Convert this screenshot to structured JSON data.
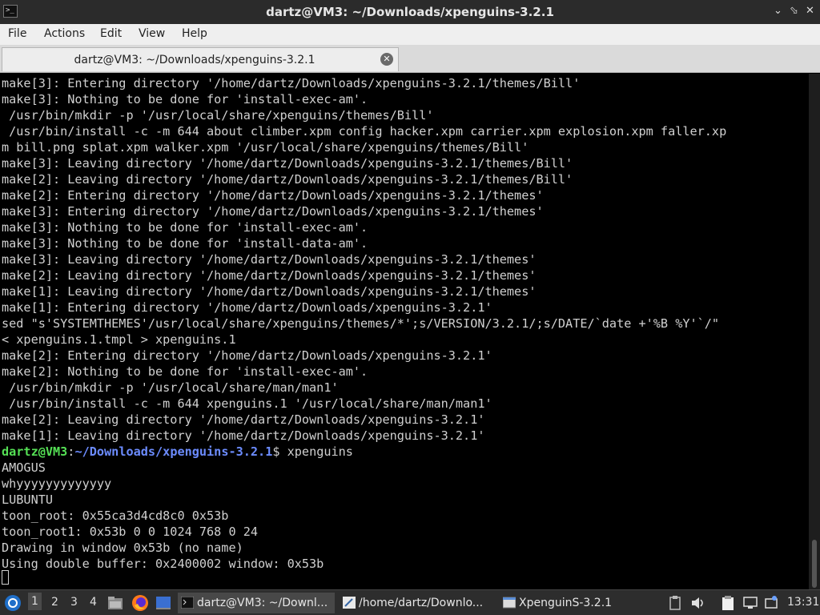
{
  "window": {
    "title": "dartz@VM3: ~/Downloads/xpenguins-3.2.1",
    "app_icon_glyph": ">_",
    "controls": [
      "⌄",
      "⬂",
      "✕"
    ]
  },
  "menu": {
    "items": [
      "File",
      "Actions",
      "Edit",
      "View",
      "Help"
    ]
  },
  "tab": {
    "title": "dartz@VM3: ~/Downloads/xpenguins-3.2.1",
    "close_glyph": "✕"
  },
  "terminal": {
    "lines": [
      "make[3]: Entering directory '/home/dartz/Downloads/xpenguins-3.2.1/themes/Bill'",
      "make[3]: Nothing to be done for 'install-exec-am'.",
      " /usr/bin/mkdir -p '/usr/local/share/xpenguins/themes/Bill'",
      " /usr/bin/install -c -m 644 about climber.xpm config hacker.xpm carrier.xpm explosion.xpm faller.xp",
      "m bill.png splat.xpm walker.xpm '/usr/local/share/xpenguins/themes/Bill'",
      "make[3]: Leaving directory '/home/dartz/Downloads/xpenguins-3.2.1/themes/Bill'",
      "make[2]: Leaving directory '/home/dartz/Downloads/xpenguins-3.2.1/themes/Bill'",
      "make[2]: Entering directory '/home/dartz/Downloads/xpenguins-3.2.1/themes'",
      "make[3]: Entering directory '/home/dartz/Downloads/xpenguins-3.2.1/themes'",
      "make[3]: Nothing to be done for 'install-exec-am'.",
      "make[3]: Nothing to be done for 'install-data-am'.",
      "make[3]: Leaving directory '/home/dartz/Downloads/xpenguins-3.2.1/themes'",
      "make[2]: Leaving directory '/home/dartz/Downloads/xpenguins-3.2.1/themes'",
      "make[1]: Leaving directory '/home/dartz/Downloads/xpenguins-3.2.1/themes'",
      "make[1]: Entering directory '/home/dartz/Downloads/xpenguins-3.2.1'",
      "sed \"s'SYSTEMTHEMES'/usr/local/share/xpenguins/themes/*';s/VERSION/3.2.1/;s/DATE/`date +'%B %Y'`/\"",
      "< xpenguins.1.tmpl > xpenguins.1",
      "make[2]: Entering directory '/home/dartz/Downloads/xpenguins-3.2.1'",
      "make[2]: Nothing to be done for 'install-exec-am'.",
      " /usr/bin/mkdir -p '/usr/local/share/man/man1'",
      " /usr/bin/install -c -m 644 xpenguins.1 '/usr/local/share/man/man1'",
      "make[2]: Leaving directory '/home/dartz/Downloads/xpenguins-3.2.1'",
      "make[1]: Leaving directory '/home/dartz/Downloads/xpenguins-3.2.1'"
    ],
    "prompt": {
      "user_host": "dartz@VM3",
      "colon": ":",
      "path": "~/Downloads/xpenguins-3.2.1",
      "symbol": "$",
      "command": " xpenguins"
    },
    "output": [
      "AMOGUS",
      "whyyyyyyyyyyyyy",
      "LUBUNTU",
      "toon_root: 0x55ca3d4cd8c0 0x53b",
      "toon_root1: 0x53b 0 0 1024 768 0 24",
      "Drawing in window 0x53b (no name)",
      "Using double buffer: 0x2400002 window: 0x53b"
    ]
  },
  "taskbar": {
    "workspaces": [
      "1",
      "2",
      "3",
      "4"
    ],
    "active_workspace": "1",
    "tasks": [
      {
        "label": "dartz@VM3: ~/Downl...",
        "icon": "terminal-icon",
        "active": true
      },
      {
        "label": "/home/dartz/Downlo...",
        "icon": "text-editor-icon",
        "active": false
      },
      {
        "label": "XpenguinS-3.2.1",
        "icon": "window-icon",
        "active": false
      }
    ],
    "clock": "13:31"
  },
  "colors": {
    "prompt_user": "#55e055",
    "prompt_path": "#6c8cff",
    "terminal_text": "#d0d0d0",
    "taskbar_bg": "#2d2d2d"
  }
}
